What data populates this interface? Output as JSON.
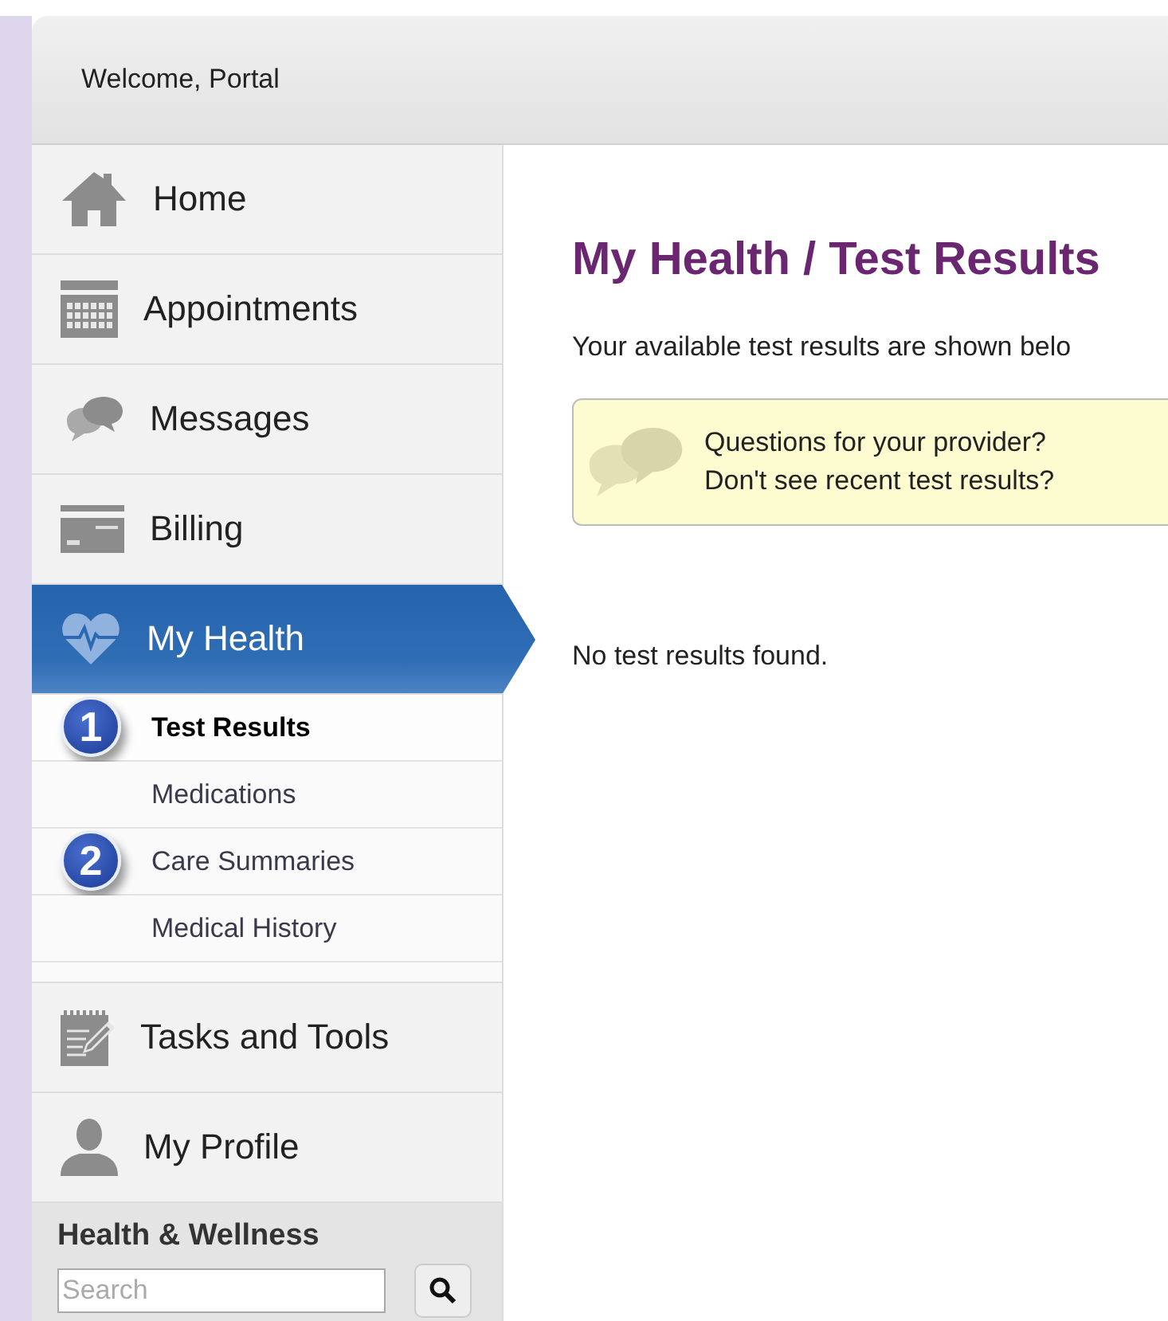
{
  "header": {
    "welcome": "Welcome, Portal"
  },
  "nav": [
    {
      "label": "Home",
      "kind": "home",
      "selected": false
    },
    {
      "label": "Appointments",
      "kind": "calendar",
      "selected": false
    },
    {
      "label": "Messages",
      "kind": "chat",
      "selected": false
    },
    {
      "label": "Billing",
      "kind": "card",
      "selected": false
    },
    {
      "label": "My Health",
      "kind": "heart",
      "selected": true,
      "children": [
        {
          "label": "Test Results",
          "selected": true,
          "callout": "1"
        },
        {
          "label": "Medications",
          "selected": false
        },
        {
          "label": "Care Summaries",
          "selected": false,
          "callout": "2"
        },
        {
          "label": "Medical History",
          "selected": false
        }
      ]
    },
    {
      "label": "Tasks and Tools",
      "kind": "tasks",
      "selected": false
    },
    {
      "label": "My Profile",
      "kind": "person",
      "selected": false
    }
  ],
  "wellness": {
    "title": "Health & Wellness",
    "search": {
      "placeholder": "Search"
    }
  },
  "main": {
    "title": "My Health / Test Results",
    "intro": "Your available test results are shown belo",
    "notice": [
      "Questions for your provider?",
      "Don't see recent test results?"
    ],
    "empty": "No test results found."
  }
}
